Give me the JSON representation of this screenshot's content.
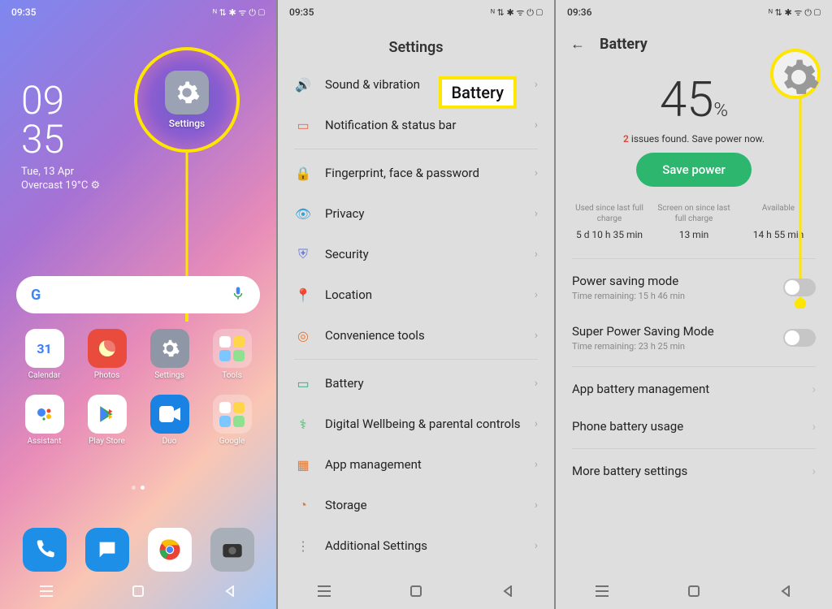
{
  "panelA": {
    "time": "09:35",
    "clock": {
      "h": "09",
      "m": "35",
      "date": "Tue, 13 Apr",
      "weather": "Overcast 19°C ⚙"
    },
    "bubble_label": "Settings",
    "apps": [
      {
        "name": "Calendar",
        "bg": "#ffffff",
        "dot": "#3a7cff",
        "extra": "31"
      },
      {
        "name": "Photos",
        "bg": "#e94b3c"
      },
      {
        "name": "Settings",
        "bg": "#8f97a6"
      },
      {
        "name": "Tools",
        "bg": "rgba(255,255,255,0.25)"
      },
      {
        "name": "Assistant",
        "bg": "#ffffff"
      },
      {
        "name": "Play Store",
        "bg": "#ffffff"
      },
      {
        "name": "Duo",
        "bg": "#1a82e2"
      },
      {
        "name": "Google",
        "bg": "rgba(255,255,255,0.25)"
      }
    ],
    "dock": [
      {
        "name": "phone-icon",
        "bg": "#1e8fe6"
      },
      {
        "name": "messages-icon",
        "bg": "#1e8fe6"
      },
      {
        "name": "chrome-icon",
        "bg": "#ffffff"
      },
      {
        "name": "camera-icon",
        "bg": "#a9afb9"
      }
    ]
  },
  "panelB": {
    "time": "09:35",
    "title": "Settings",
    "tag": "Battery",
    "items": [
      {
        "icon": "sound-icon",
        "label": "Sound & vibration",
        "color": "#45b86b"
      },
      {
        "icon": "notification-icon",
        "label": "Notification & status bar",
        "color": "#e66a4a"
      },
      {
        "icon": "fingerprint-icon",
        "label": "Fingerprint, face & password",
        "color": "#33a0d6"
      },
      {
        "icon": "privacy-icon",
        "label": "Privacy",
        "color": "#33a0d6"
      },
      {
        "icon": "security-icon",
        "label": "Security",
        "color": "#6a7be0"
      },
      {
        "icon": "location-icon",
        "label": "Location",
        "color": "#e07a3a"
      },
      {
        "icon": "convenience-icon",
        "label": "Convenience tools",
        "color": "#e07a3a"
      },
      {
        "icon": "battery-icon",
        "label": "Battery",
        "color": "#3aa886"
      },
      {
        "icon": "wellbeing-icon",
        "label": "Digital Wellbeing & parental controls",
        "color": "#45b86b"
      },
      {
        "icon": "apps-icon",
        "label": "App management",
        "color": "#e07a3a"
      },
      {
        "icon": "storage-icon",
        "label": "Storage",
        "color": "#e07a3a"
      },
      {
        "icon": "additional-icon",
        "label": "Additional Settings",
        "color": "#888"
      }
    ]
  },
  "panelC": {
    "time": "09:36",
    "title": "Battery",
    "pct": "45",
    "pct_sym": "%",
    "issues_count": "2",
    "issues_rest": " issues found. Save power now.",
    "save_btn": "Save power",
    "stats": [
      {
        "h": "Used since last full charge",
        "v": "5 d 10 h 35 min"
      },
      {
        "h": "Screen on since last full charge",
        "v": "13 min"
      },
      {
        "h": "Available",
        "v": "14 h 55 min"
      }
    ],
    "rows": [
      {
        "t1": "Power saving mode",
        "t2": "Time remaining:  15 h 46 min",
        "toggle": true
      },
      {
        "t1": "Super Power Saving Mode",
        "t2": "Time remaining:  23 h 25 min",
        "toggle": true
      },
      {
        "t1": "App battery management",
        "chev": true
      },
      {
        "t1": "Phone battery usage",
        "chev": true
      },
      {
        "t1": "More battery settings",
        "chev": true
      }
    ]
  },
  "status_icons": "ᴺ ⇅ ✱ ᯤ ⏻ ▢"
}
